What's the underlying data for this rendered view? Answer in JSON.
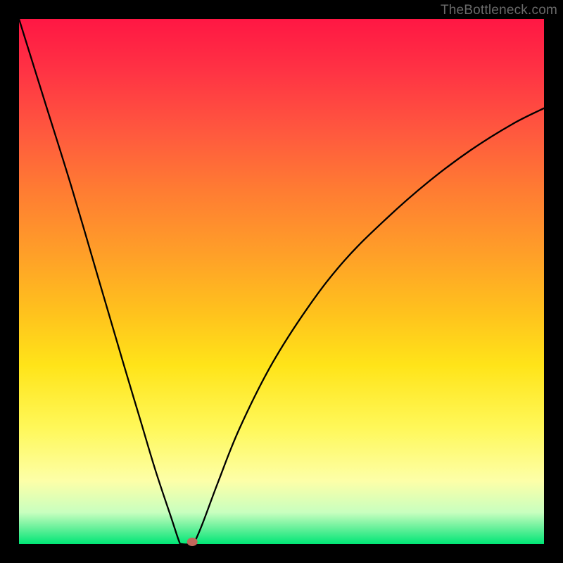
{
  "watermark": "TheBottleneck.com",
  "chart_data": {
    "type": "line",
    "title": "",
    "xlabel": "",
    "ylabel": "",
    "xlim": [
      0,
      100
    ],
    "ylim": [
      0,
      100
    ],
    "series": [
      {
        "name": "curve",
        "x": [
          0,
          5,
          10,
          15,
          20,
          23,
          26,
          29,
          30.5,
          31,
          33,
          33.5,
          35,
          38,
          42,
          48,
          55,
          62,
          70,
          78,
          86,
          94,
          100
        ],
        "values": [
          100,
          84,
          68,
          51,
          34,
          24,
          14,
          5,
          0.5,
          0,
          0,
          0.5,
          4,
          12,
          22,
          34,
          45,
          54,
          62,
          69,
          75,
          80,
          83
        ]
      }
    ],
    "marker": {
      "x": 33,
      "y": 0,
      "color": "#c1675b"
    }
  }
}
